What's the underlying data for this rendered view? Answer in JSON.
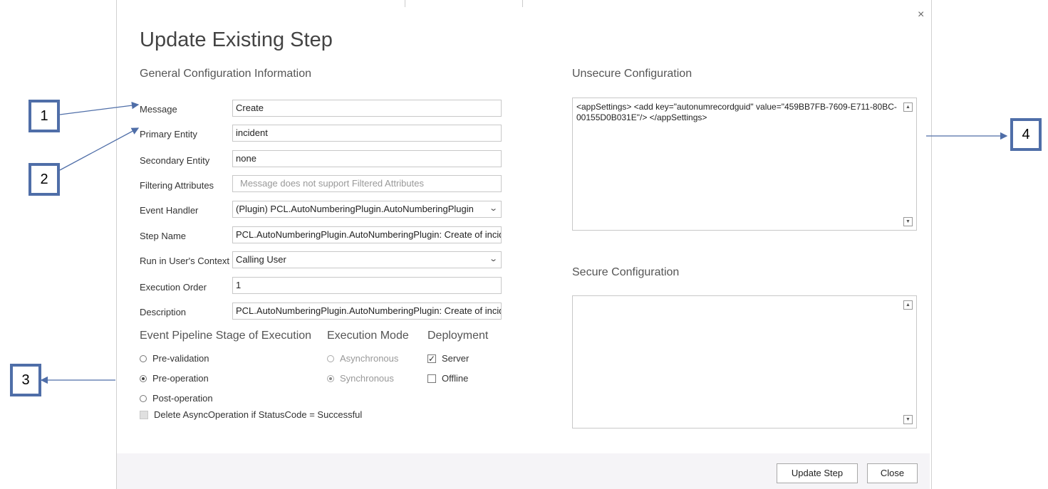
{
  "dialog": {
    "title": "Update Existing Step",
    "close_glyph": "×"
  },
  "general": {
    "heading": "General Configuration Information",
    "fields": [
      {
        "label": "Message",
        "value": "Create",
        "placeholder": ""
      },
      {
        "label": "Primary Entity",
        "value": "incident",
        "placeholder": ""
      },
      {
        "label": "Secondary Entity",
        "value": "none",
        "placeholder": ""
      },
      {
        "label": "Filtering Attributes",
        "value": "",
        "placeholder": "Message does not support Filtered Attributes"
      },
      {
        "label": "Event Handler",
        "value": "(Plugin) PCL.AutoNumberingPlugin.AutoNumberingPlugin",
        "placeholder": ""
      },
      {
        "label": "Step Name",
        "value": "PCL.AutoNumberingPlugin.AutoNumberingPlugin: Create of incide",
        "placeholder": ""
      },
      {
        "label": "Run in User's Context",
        "value": "Calling User",
        "placeholder": ""
      },
      {
        "label": "Execution Order",
        "value": "1",
        "placeholder": ""
      },
      {
        "label": "Description",
        "value": "PCL.AutoNumberingPlugin.AutoNumberingPlugin: Create of incide",
        "placeholder": ""
      }
    ]
  },
  "pipeline": {
    "heading": "Event Pipeline Stage of Execution",
    "options": [
      "Pre-validation",
      "Pre-operation",
      "Post-operation"
    ],
    "selected": "Pre-operation",
    "delete_async_label": "Delete AsyncOperation if StatusCode = Successful"
  },
  "execution_mode": {
    "heading": "Execution Mode",
    "options": [
      "Asynchronous",
      "Synchronous"
    ],
    "selected": "Synchronous"
  },
  "deployment": {
    "heading": "Deployment",
    "options": [
      "Server",
      "Offline"
    ],
    "server_checked": true,
    "offline_checked": false,
    "check_glyph": "✓"
  },
  "unsecure": {
    "heading": "Unsecure  Configuration",
    "value": "<appSettings> <add key=\"autonumrecordguid\" value=\"459BB7FB-7609-E711-80BC-00155D0B031E\"/> </appSettings>"
  },
  "secure": {
    "heading": "Secure  Configuration",
    "value": ""
  },
  "buttons": {
    "update": "Update Step",
    "close": "Close"
  },
  "callouts": [
    "1",
    "2",
    "3",
    "4"
  ],
  "colors": {
    "callout_border": "#4f6ea8",
    "footer_bg": "#f5f4f7"
  }
}
